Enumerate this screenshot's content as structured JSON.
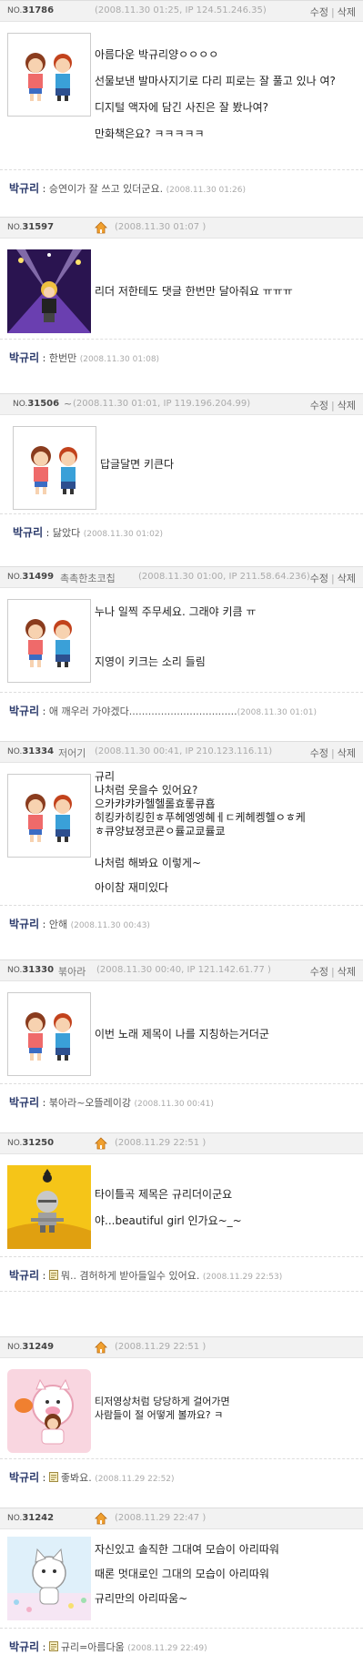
{
  "actions": {
    "edit": "수정",
    "separator": "|",
    "delete": "삭제"
  },
  "posts": [
    {
      "no_prefix": "NO.",
      "no": "31786",
      "author": "",
      "meta": "(2008.11.30 01:25, IP 124.51.246.35)",
      "body": [
        "아름다운 박규리양ㅇㅇㅇㅇ",
        "선물보낸 발마사지기로 다리 피로는 잘 풀고 있나 여?",
        "디지털 액자에 담긴 사진은 잘 봤나여?",
        "만화책은요? ㅋㅋㅋㅋㅋ"
      ],
      "reply": {
        "author": "박규리",
        "colon": " : ",
        "text": "승연이가 잘 쓰고 있더군요.",
        "date": "(2008.11.30 01:26)"
      }
    },
    {
      "no_prefix": "NO.",
      "no": "31597",
      "author": "",
      "meta": "(2008.11.30 01:07 )",
      "body": [
        "리더 저한테도 댓글 한번만 달아줘요 ㅠㅠㅠ"
      ],
      "reply": {
        "author": "박규리",
        "colon": " : ",
        "text": "한번만",
        "date": "(2008.11.30 01:08)"
      }
    },
    {
      "no_prefix": "NO.",
      "no": "31506",
      "author": "~",
      "meta": "(2008.11.30 01:01, IP 119.196.204.99)",
      "body": [
        "답글달면 키큰다"
      ],
      "reply": {
        "author": "박규리",
        "colon": " : ",
        "text": "닳았다",
        "date": "(2008.11.30 01:02)"
      }
    },
    {
      "no_prefix": "NO.",
      "no": "31499",
      "author": "촉촉한초코칩",
      "meta": "(2008.11.30 01:00, IP 211.58.64.236)",
      "body": [
        "누나 일찍 주무세요. 그래야 키큼 ㅠ",
        "지영이 키크는 소리 들림"
      ],
      "reply": {
        "author": "박규리",
        "colon": " : ",
        "text": "애 깨우러 가야겠다..................................",
        "date": "(2008.11.30 01:01)"
      }
    },
    {
      "no_prefix": "NO.",
      "no": "31334",
      "author": "저어기",
      "meta": "(2008.11.30 00:41, IP 210.123.116.11)",
      "body": [
        "규리",
        "나처럼 웃을수 있어요?",
        "으카캬캬카헬헬롤효롷큐횹",
        "히킹카히킹힌ㅎ푸헤엥엥혜ㅔㄷ케헤켕헬ㅇㅎ케",
        "ㅎ큐양뵤졍코쿈ㅇ률교쿄률쿄",
        "나처럼 해봐요 이렇게~",
        "아이참 재미있다"
      ],
      "reply": {
        "author": "박규리",
        "colon": " : ",
        "text": "안해",
        "date": "(2008.11.30 00:43)"
      }
    },
    {
      "no_prefix": "NO.",
      "no": "31330",
      "author": "붂아라",
      "meta": "(2008.11.30 00:40, IP 121.142.61.77 )",
      "body": [
        "이번 노래 제목이 나를 지칭하는거더군"
      ],
      "reply": {
        "author": "박규리",
        "colon": " : ",
        "text": "붂아라~오뜰레이강",
        "date": "(2008.11.30 00:41)"
      }
    },
    {
      "no_prefix": "NO.",
      "no": "31250",
      "author": "",
      "meta": "(2008.11.29 22:51 )",
      "body": [
        "타이틀곡 제목은 규리더이군요",
        "야...beautiful girl 인가요~_~"
      ],
      "reply": {
        "author": "박규리",
        "colon": " : ",
        "text": "뭐.. 겸허하게 받아들일수 있어요.",
        "date": "(2008.11.29 22:53)"
      }
    },
    {
      "no_prefix": "NO.",
      "no": "31249",
      "author": "",
      "meta": "(2008.11.29 22:51 )",
      "body": [
        "티저영상처럼 당당하게 걸어가면",
        "사람들이 절 어떻게 볼까요? ㅋ"
      ],
      "reply": {
        "author": "박규리",
        "colon": " : ",
        "text": "좋봐요.",
        "date": "(2008.11.29 22:52)"
      }
    },
    {
      "no_prefix": "NO.",
      "no": "31242",
      "author": "",
      "meta": "(2008.11.29 22:47 )",
      "body": [
        "자신있고 솔직한 그대여 모습이 아리따워",
        "때론 멋대로인 그대의 모습이 아리따워",
        "규리만의 아리따움~"
      ],
      "reply": {
        "author": "박규리",
        "colon": " : ",
        "text": "규리=아름다움",
        "date": "(2008.11.29 22:49)"
      }
    }
  ]
}
